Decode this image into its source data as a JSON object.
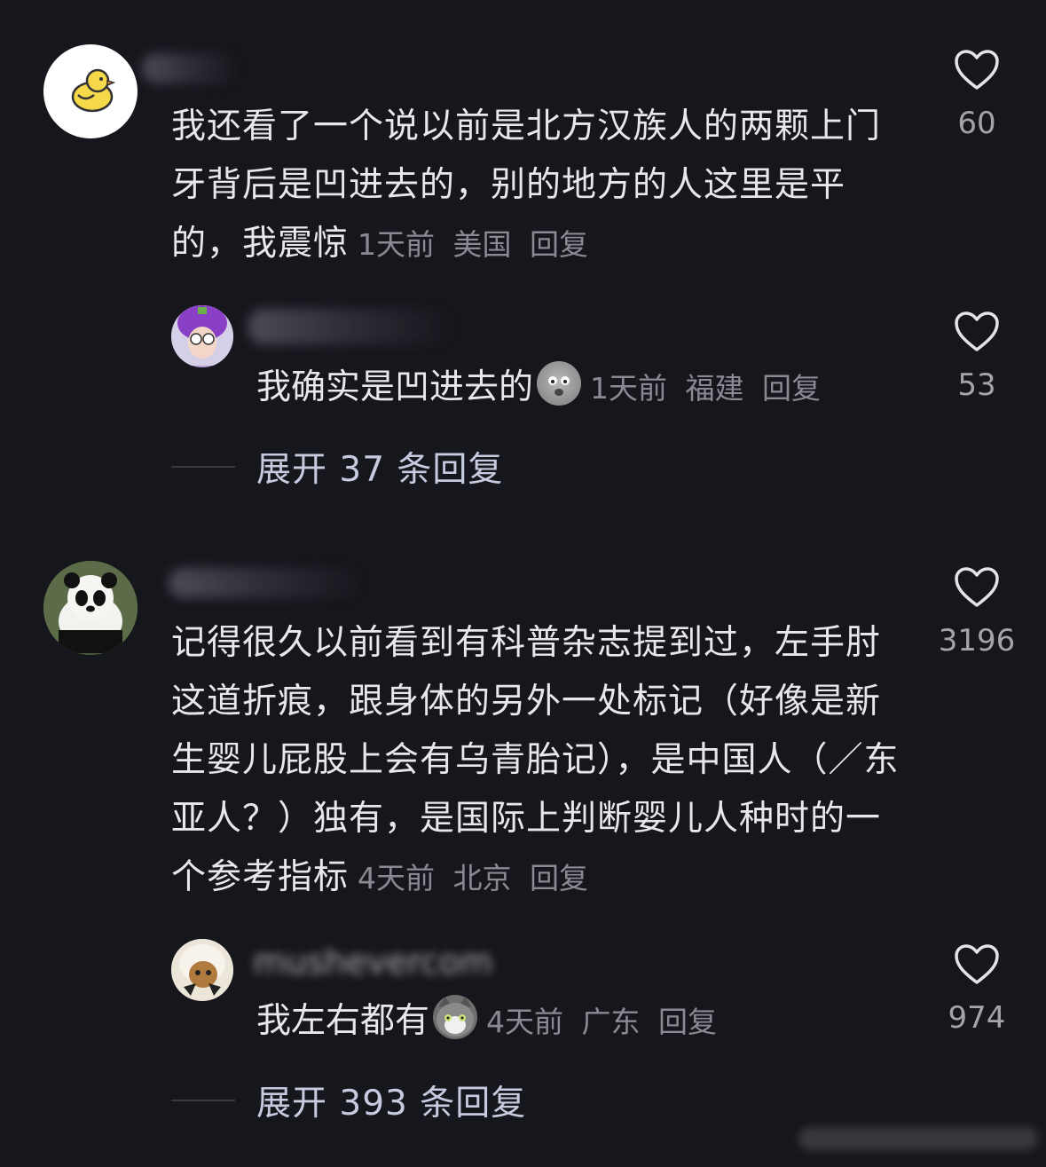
{
  "comments": [
    {
      "avatar_icon": "chick-icon",
      "text": "我还看了一个说以前是北方汉族人的两颗上门牙背后是凹进去的，别的地方的人这里是平的，我震惊",
      "time": "1天前",
      "location": "美国",
      "reply_label": "回复",
      "likes": "60",
      "reply": {
        "avatar_icon": "purple-hat-avatar-icon",
        "text": "我确实是凹进去的",
        "emoji": "worried-emoji-icon",
        "time": "1天前",
        "location": "福建",
        "reply_label": "回复",
        "likes": "53"
      },
      "expand_label": "展开 37 条回复"
    },
    {
      "avatar_icon": "panda-icon",
      "text": "记得很久以前看到有科普杂志提到过，左手肘这道折痕，跟身体的另外一处标记（好像是新生婴儿屁股上会有乌青胎记），是中国人（／东亚人？）独有，是国际上判断婴儿人种时的一个参考指标",
      "time": "4天前",
      "location": "北京",
      "reply_label": "回复",
      "likes": "3196",
      "reply": {
        "username": "mushevercom",
        "avatar_icon": "cat-bonnet-avatar-icon",
        "text": "我左右都有",
        "emoji": "cat-emoji-icon",
        "time": "4天前",
        "location": "广东",
        "reply_label": "回复",
        "likes": "974"
      },
      "expand_label": "展开 393 条回复"
    }
  ],
  "colors": {
    "background": "#16161d",
    "text": "#e8e8ea",
    "meta": "#8a8a92",
    "expand": "#c7cbe0"
  }
}
